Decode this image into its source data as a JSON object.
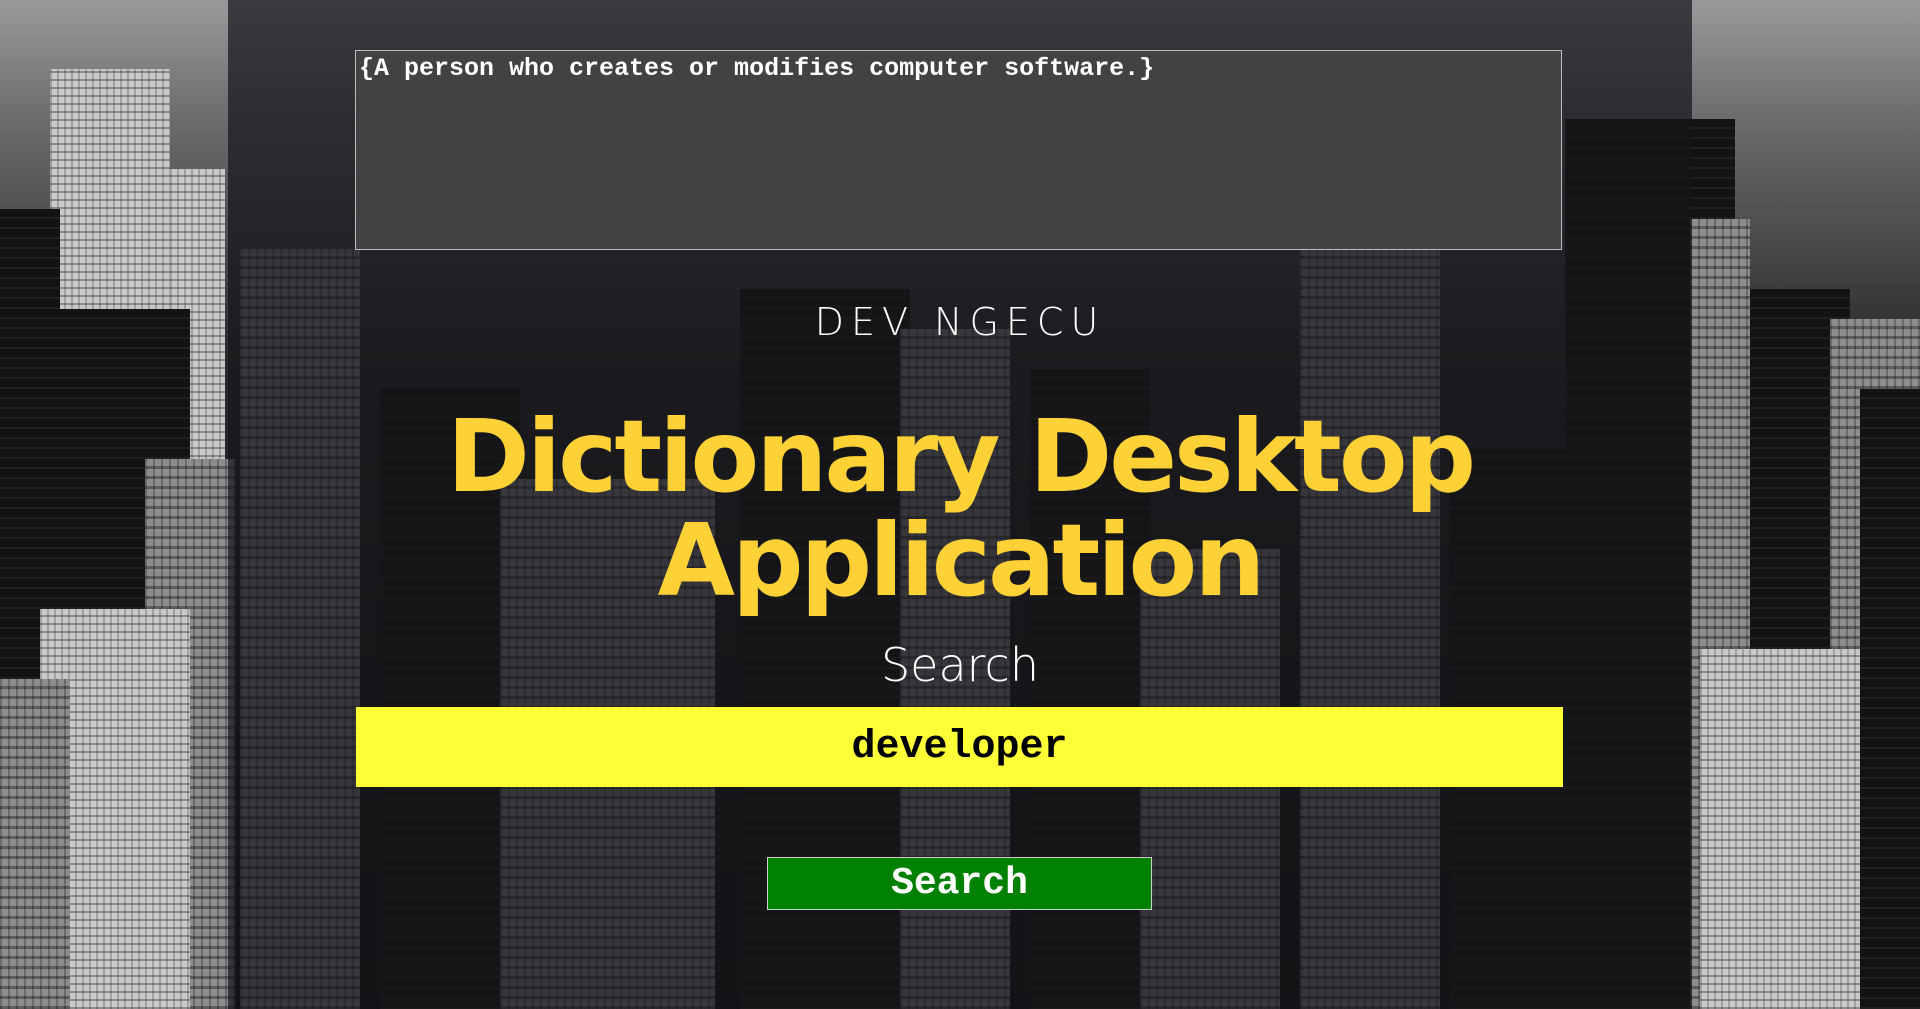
{
  "app": {
    "brand": "DEV NGECU",
    "title": "Dictionary Desktop Application"
  },
  "result": {
    "text": "{A person who creates or modifies computer software.}"
  },
  "search": {
    "heading": "Search",
    "input_value": "developer",
    "button_label": "Search"
  },
  "colors": {
    "title": "#fed136",
    "input_background": "#ffff38",
    "button_background": "#008000",
    "result_background": "#424244"
  }
}
